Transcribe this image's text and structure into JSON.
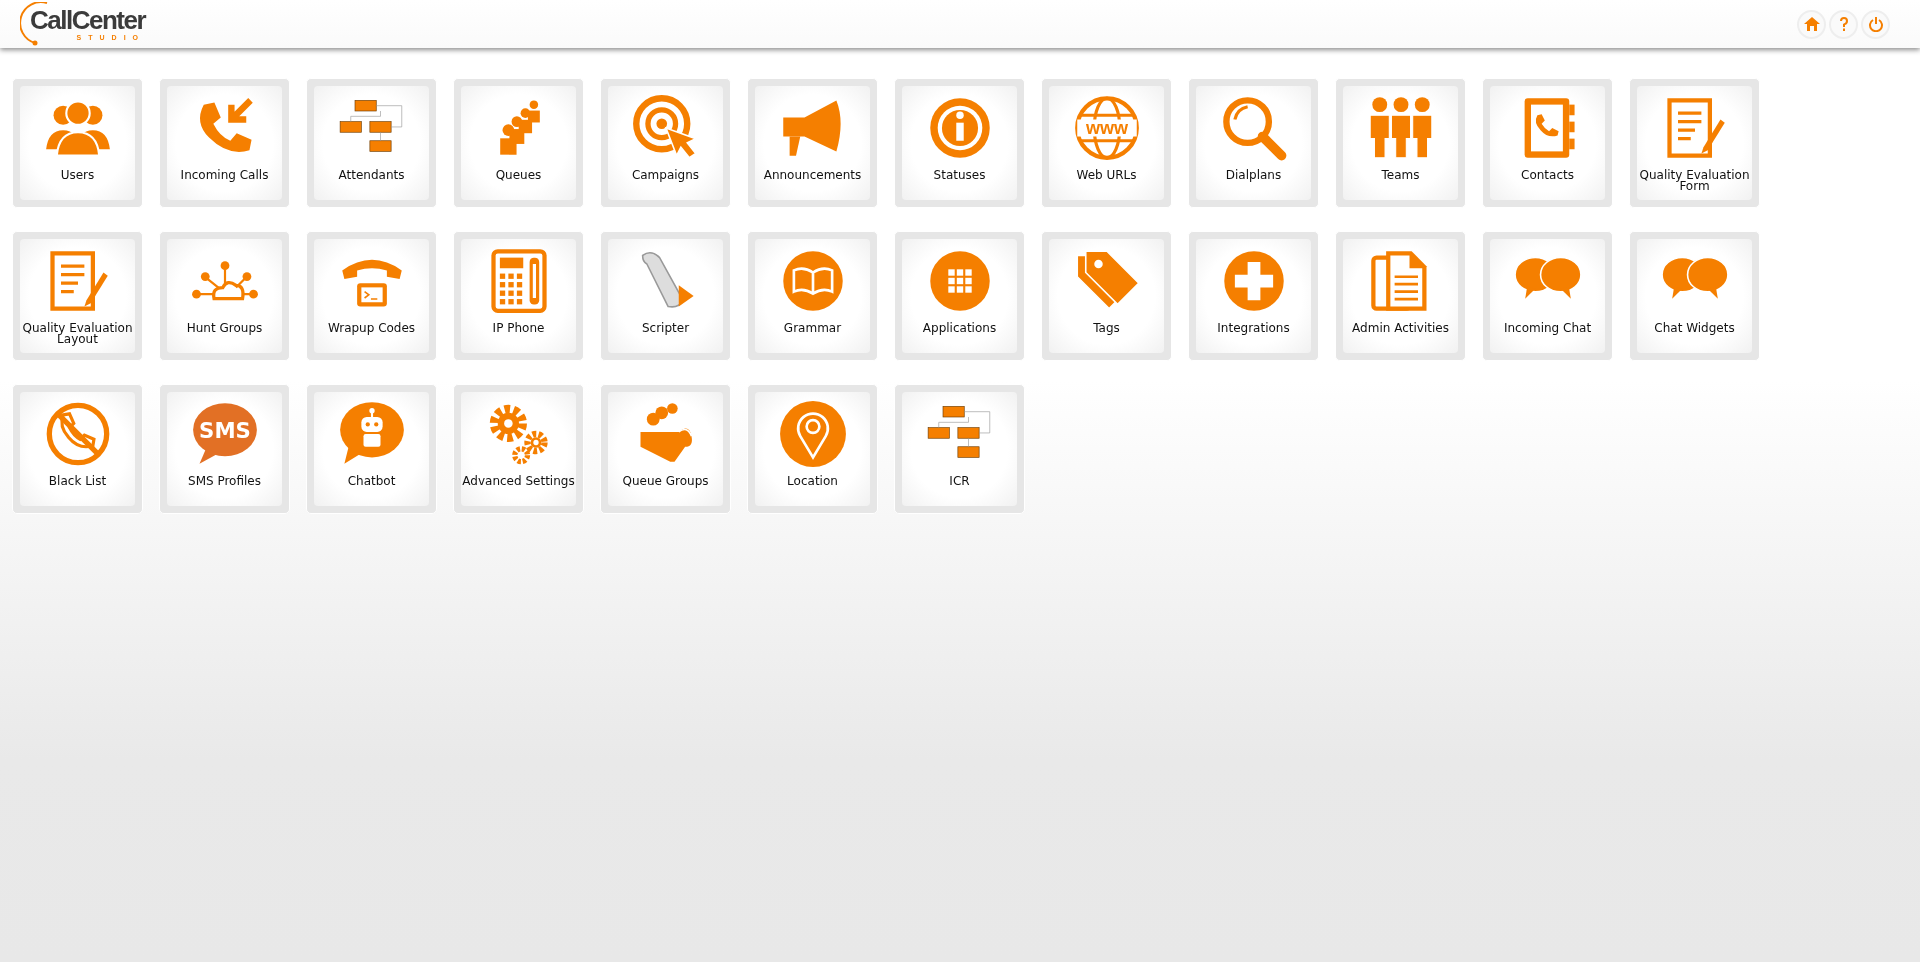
{
  "header": {
    "logo": {
      "name": "CallCenter",
      "subtitle": "STUDIO"
    },
    "buttons": [
      {
        "kind": "home"
      },
      {
        "kind": "help"
      },
      {
        "kind": "power"
      }
    ]
  },
  "tiles": [
    {
      "label": "Users"
    },
    {
      "label": "Incoming Calls"
    },
    {
      "label": "Attendants"
    },
    {
      "label": "Queues"
    },
    {
      "label": "Campaigns"
    },
    {
      "label": "Announcements"
    },
    {
      "label": "Statuses"
    },
    {
      "label": "Web URLs",
      "icon_text": "www"
    },
    {
      "label": "Dialplans"
    },
    {
      "label": "Teams"
    },
    {
      "label": "Contacts"
    },
    {
      "label": "Quality Evaluation Form"
    },
    {
      "label": "Quality Evaluation Layout"
    },
    {
      "label": "Hunt Groups"
    },
    {
      "label": "Wrapup Codes"
    },
    {
      "label": "IP Phone"
    },
    {
      "label": "Scripter"
    },
    {
      "label": "Grammar"
    },
    {
      "label": "Applications"
    },
    {
      "label": "Tags"
    },
    {
      "label": "Integrations"
    },
    {
      "label": "Admin Activities"
    },
    {
      "label": "Incoming Chat"
    },
    {
      "label": "Chat Widgets"
    },
    {
      "label": "Black List"
    },
    {
      "label": "SMS Profiles",
      "icon_text": "SMS"
    },
    {
      "label": "Chatbot"
    },
    {
      "label": "Advanced Settings"
    },
    {
      "label": "Queue Groups"
    },
    {
      "label": "Location"
    },
    {
      "label": "ICR"
    }
  ]
}
